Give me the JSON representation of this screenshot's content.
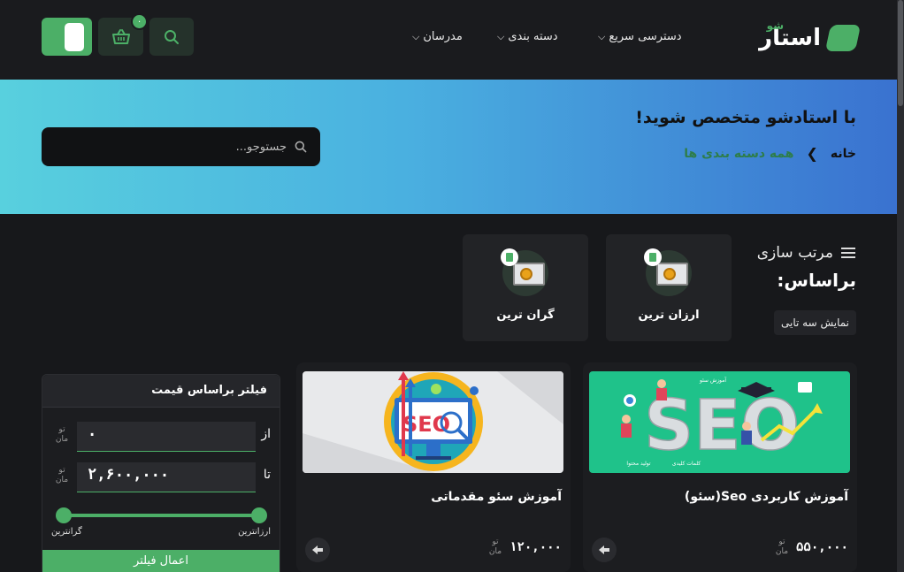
{
  "header": {
    "logo_text": "استار",
    "logo_sub": "شو",
    "nav": [
      {
        "label": "دسترسی سریع"
      },
      {
        "label": "دسته بندی"
      },
      {
        "label": "مدرسان"
      }
    ],
    "cart_count": "۰"
  },
  "hero": {
    "title": "با استادشو متخصص شوید!",
    "breadcrumb_home": "خانه",
    "breadcrumb_current": "همه دسته بندی ها",
    "search_placeholder": "جستوجو..."
  },
  "sort": {
    "title": "مرتب سازی",
    "subtitle": "براساس:",
    "three_col": "نمایش سه تایی",
    "options": [
      {
        "label": "ارزان ترین"
      },
      {
        "label": "گران ترین"
      }
    ]
  },
  "filter": {
    "title": "فیلتر براساس قیمت",
    "from_label": "از",
    "to_label": "تا",
    "from_value": "۰",
    "to_value": "۲,۶۰۰,۰۰۰",
    "currency_top": "تو",
    "currency_bottom": "مان",
    "min_label": "ارزانترین",
    "max_label": "گرانترین",
    "apply": "اعمال فیلتر"
  },
  "courses": [
    {
      "title": "آموزش کاربردی Seo(سئو)",
      "price": "۵۵۰,۰۰۰",
      "thumb_text": "SEO",
      "thumb_words": [
        "آموزش سئو",
        "کلمات کلیدی",
        "تولید محتوا"
      ]
    },
    {
      "title": "آموزش سئو مقدماتی",
      "price": "۱۲۰,۰۰۰",
      "thumb_text": "SEO"
    }
  ],
  "colors": {
    "accent": "#4caf67",
    "background": "#17181b",
    "card": "#1c1d20",
    "hero_start": "#58d0de",
    "hero_end": "#3a72d0"
  }
}
